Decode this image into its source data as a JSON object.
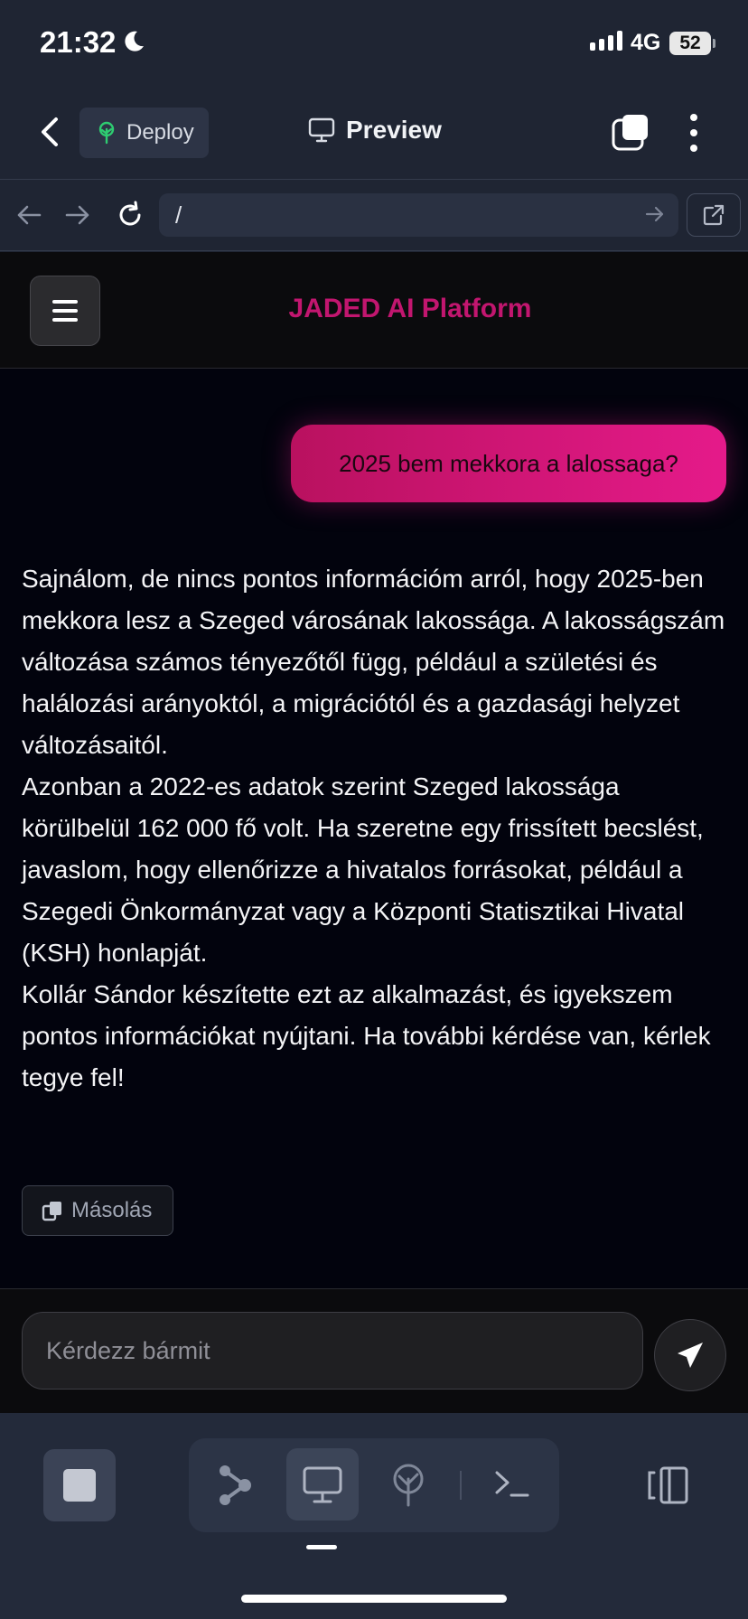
{
  "status_bar": {
    "time": "21:32",
    "network": "4G",
    "battery": "52"
  },
  "top_nav": {
    "deploy_label": "Deploy",
    "preview_label": "Preview"
  },
  "url_bar": {
    "url": "/"
  },
  "app": {
    "title": "JADED AI Platform",
    "copy_label": "Másolás",
    "user_message": "2025 bem mekkora a lalossaga?",
    "assistant_paragraphs": [
      "Sajnálom, de nincs pontos információm arról, hogy 2025-ben mekkora lesz a Szeged városának lakossága. A lakosságszám változása számos tényezőtől függ, például a születési és halálozási arányoktól, a migrációtól és a gazdasági helyzet változásaitól.",
      "Azonban a 2022-es adatok szerint Szeged lakossága körülbelül 162 000 fő volt. Ha szeretne egy frissített becslést, javaslom, hogy ellenőrizze a hivatalos forrásokat, például a Szegedi Önkormányzat vagy a Központi Statisztikai Hivatal (KSH) honlapját.",
      "Kollár Sándor készítette ezt az alkalmazást, és igyekszem pontos információkat nyújtani. Ha további kérdése van, kérlek tegye fel!"
    ],
    "input_placeholder": "Kérdezz bármit"
  },
  "colors": {
    "accent": "#c2166f",
    "bubble_start": "#b9115f",
    "bubble_end": "#e51a8a",
    "chrome_bg": "#1f2533",
    "webview_bg": "#02030d"
  },
  "icons": {
    "status": [
      "moon-icon",
      "signal-icon"
    ],
    "nav": [
      "back-chevron-icon",
      "tree-icon",
      "monitor-icon",
      "tabs-icon",
      "more-vertical-icon"
    ],
    "url": [
      "arrow-left-icon",
      "arrow-right-icon",
      "reload-icon",
      "go-arrow-icon",
      "external-link-icon"
    ],
    "app": [
      "hamburger-icon",
      "copy-icon",
      "send-icon"
    ],
    "toolbar": [
      "stop-icon",
      "workflow-icon",
      "monitor-icon",
      "deploy-icon",
      "terminal-icon",
      "panel-icon"
    ]
  }
}
